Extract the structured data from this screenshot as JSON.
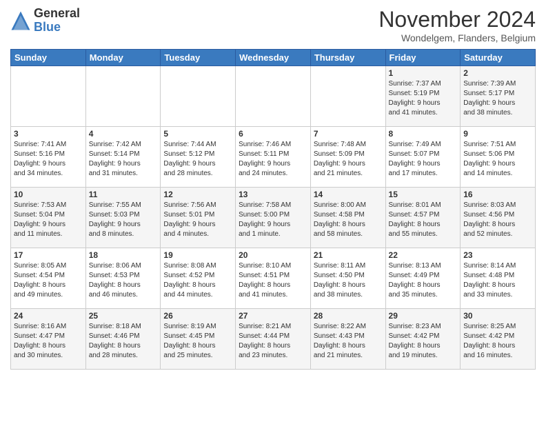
{
  "logo": {
    "general": "General",
    "blue": "Blue"
  },
  "title": "November 2024",
  "location": "Wondelgem, Flanders, Belgium",
  "headers": [
    "Sunday",
    "Monday",
    "Tuesday",
    "Wednesday",
    "Thursday",
    "Friday",
    "Saturday"
  ],
  "weeks": [
    [
      {
        "day": "",
        "info": ""
      },
      {
        "day": "",
        "info": ""
      },
      {
        "day": "",
        "info": ""
      },
      {
        "day": "",
        "info": ""
      },
      {
        "day": "",
        "info": ""
      },
      {
        "day": "1",
        "info": "Sunrise: 7:37 AM\nSunset: 5:19 PM\nDaylight: 9 hours\nand 41 minutes."
      },
      {
        "day": "2",
        "info": "Sunrise: 7:39 AM\nSunset: 5:17 PM\nDaylight: 9 hours\nand 38 minutes."
      }
    ],
    [
      {
        "day": "3",
        "info": "Sunrise: 7:41 AM\nSunset: 5:16 PM\nDaylight: 9 hours\nand 34 minutes."
      },
      {
        "day": "4",
        "info": "Sunrise: 7:42 AM\nSunset: 5:14 PM\nDaylight: 9 hours\nand 31 minutes."
      },
      {
        "day": "5",
        "info": "Sunrise: 7:44 AM\nSunset: 5:12 PM\nDaylight: 9 hours\nand 28 minutes."
      },
      {
        "day": "6",
        "info": "Sunrise: 7:46 AM\nSunset: 5:11 PM\nDaylight: 9 hours\nand 24 minutes."
      },
      {
        "day": "7",
        "info": "Sunrise: 7:48 AM\nSunset: 5:09 PM\nDaylight: 9 hours\nand 21 minutes."
      },
      {
        "day": "8",
        "info": "Sunrise: 7:49 AM\nSunset: 5:07 PM\nDaylight: 9 hours\nand 17 minutes."
      },
      {
        "day": "9",
        "info": "Sunrise: 7:51 AM\nSunset: 5:06 PM\nDaylight: 9 hours\nand 14 minutes."
      }
    ],
    [
      {
        "day": "10",
        "info": "Sunrise: 7:53 AM\nSunset: 5:04 PM\nDaylight: 9 hours\nand 11 minutes."
      },
      {
        "day": "11",
        "info": "Sunrise: 7:55 AM\nSunset: 5:03 PM\nDaylight: 9 hours\nand 8 minutes."
      },
      {
        "day": "12",
        "info": "Sunrise: 7:56 AM\nSunset: 5:01 PM\nDaylight: 9 hours\nand 4 minutes."
      },
      {
        "day": "13",
        "info": "Sunrise: 7:58 AM\nSunset: 5:00 PM\nDaylight: 9 hours\nand 1 minute."
      },
      {
        "day": "14",
        "info": "Sunrise: 8:00 AM\nSunset: 4:58 PM\nDaylight: 8 hours\nand 58 minutes."
      },
      {
        "day": "15",
        "info": "Sunrise: 8:01 AM\nSunset: 4:57 PM\nDaylight: 8 hours\nand 55 minutes."
      },
      {
        "day": "16",
        "info": "Sunrise: 8:03 AM\nSunset: 4:56 PM\nDaylight: 8 hours\nand 52 minutes."
      }
    ],
    [
      {
        "day": "17",
        "info": "Sunrise: 8:05 AM\nSunset: 4:54 PM\nDaylight: 8 hours\nand 49 minutes."
      },
      {
        "day": "18",
        "info": "Sunrise: 8:06 AM\nSunset: 4:53 PM\nDaylight: 8 hours\nand 46 minutes."
      },
      {
        "day": "19",
        "info": "Sunrise: 8:08 AM\nSunset: 4:52 PM\nDaylight: 8 hours\nand 44 minutes."
      },
      {
        "day": "20",
        "info": "Sunrise: 8:10 AM\nSunset: 4:51 PM\nDaylight: 8 hours\nand 41 minutes."
      },
      {
        "day": "21",
        "info": "Sunrise: 8:11 AM\nSunset: 4:50 PM\nDaylight: 8 hours\nand 38 minutes."
      },
      {
        "day": "22",
        "info": "Sunrise: 8:13 AM\nSunset: 4:49 PM\nDaylight: 8 hours\nand 35 minutes."
      },
      {
        "day": "23",
        "info": "Sunrise: 8:14 AM\nSunset: 4:48 PM\nDaylight: 8 hours\nand 33 minutes."
      }
    ],
    [
      {
        "day": "24",
        "info": "Sunrise: 8:16 AM\nSunset: 4:47 PM\nDaylight: 8 hours\nand 30 minutes."
      },
      {
        "day": "25",
        "info": "Sunrise: 8:18 AM\nSunset: 4:46 PM\nDaylight: 8 hours\nand 28 minutes."
      },
      {
        "day": "26",
        "info": "Sunrise: 8:19 AM\nSunset: 4:45 PM\nDaylight: 8 hours\nand 25 minutes."
      },
      {
        "day": "27",
        "info": "Sunrise: 8:21 AM\nSunset: 4:44 PM\nDaylight: 8 hours\nand 23 minutes."
      },
      {
        "day": "28",
        "info": "Sunrise: 8:22 AM\nSunset: 4:43 PM\nDaylight: 8 hours\nand 21 minutes."
      },
      {
        "day": "29",
        "info": "Sunrise: 8:23 AM\nSunset: 4:42 PM\nDaylight: 8 hours\nand 19 minutes."
      },
      {
        "day": "30",
        "info": "Sunrise: 8:25 AM\nSunset: 4:42 PM\nDaylight: 8 hours\nand 16 minutes."
      }
    ]
  ]
}
